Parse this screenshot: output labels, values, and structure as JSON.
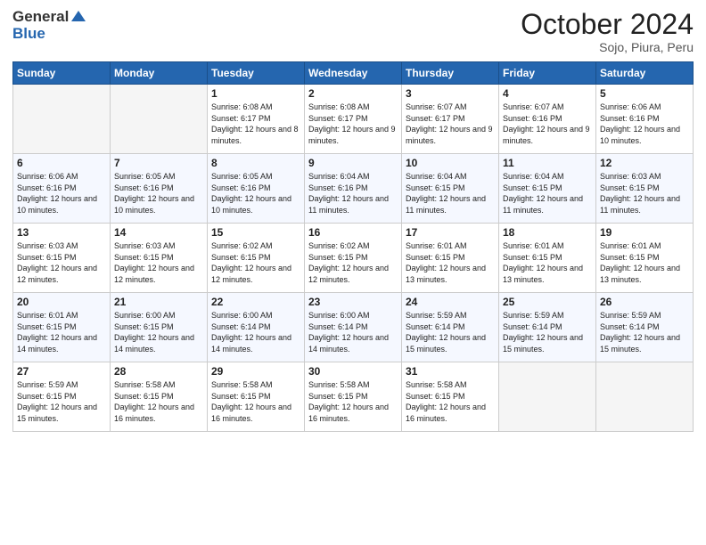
{
  "header": {
    "logo_general": "General",
    "logo_blue": "Blue",
    "month_title": "October 2024",
    "location": "Sojo, Piura, Peru"
  },
  "days_of_week": [
    "Sunday",
    "Monday",
    "Tuesday",
    "Wednesday",
    "Thursday",
    "Friday",
    "Saturday"
  ],
  "weeks": [
    [
      {
        "day": "",
        "info": ""
      },
      {
        "day": "",
        "info": ""
      },
      {
        "day": "1",
        "info": "Sunrise: 6:08 AM\nSunset: 6:17 PM\nDaylight: 12 hours and 8 minutes."
      },
      {
        "day": "2",
        "info": "Sunrise: 6:08 AM\nSunset: 6:17 PM\nDaylight: 12 hours and 9 minutes."
      },
      {
        "day": "3",
        "info": "Sunrise: 6:07 AM\nSunset: 6:17 PM\nDaylight: 12 hours and 9 minutes."
      },
      {
        "day": "4",
        "info": "Sunrise: 6:07 AM\nSunset: 6:16 PM\nDaylight: 12 hours and 9 minutes."
      },
      {
        "day": "5",
        "info": "Sunrise: 6:06 AM\nSunset: 6:16 PM\nDaylight: 12 hours and 10 minutes."
      }
    ],
    [
      {
        "day": "6",
        "info": "Sunrise: 6:06 AM\nSunset: 6:16 PM\nDaylight: 12 hours and 10 minutes."
      },
      {
        "day": "7",
        "info": "Sunrise: 6:05 AM\nSunset: 6:16 PM\nDaylight: 12 hours and 10 minutes."
      },
      {
        "day": "8",
        "info": "Sunrise: 6:05 AM\nSunset: 6:16 PM\nDaylight: 12 hours and 10 minutes."
      },
      {
        "day": "9",
        "info": "Sunrise: 6:04 AM\nSunset: 6:16 PM\nDaylight: 12 hours and 11 minutes."
      },
      {
        "day": "10",
        "info": "Sunrise: 6:04 AM\nSunset: 6:15 PM\nDaylight: 12 hours and 11 minutes."
      },
      {
        "day": "11",
        "info": "Sunrise: 6:04 AM\nSunset: 6:15 PM\nDaylight: 12 hours and 11 minutes."
      },
      {
        "day": "12",
        "info": "Sunrise: 6:03 AM\nSunset: 6:15 PM\nDaylight: 12 hours and 11 minutes."
      }
    ],
    [
      {
        "day": "13",
        "info": "Sunrise: 6:03 AM\nSunset: 6:15 PM\nDaylight: 12 hours and 12 minutes."
      },
      {
        "day": "14",
        "info": "Sunrise: 6:03 AM\nSunset: 6:15 PM\nDaylight: 12 hours and 12 minutes."
      },
      {
        "day": "15",
        "info": "Sunrise: 6:02 AM\nSunset: 6:15 PM\nDaylight: 12 hours and 12 minutes."
      },
      {
        "day": "16",
        "info": "Sunrise: 6:02 AM\nSunset: 6:15 PM\nDaylight: 12 hours and 12 minutes."
      },
      {
        "day": "17",
        "info": "Sunrise: 6:01 AM\nSunset: 6:15 PM\nDaylight: 12 hours and 13 minutes."
      },
      {
        "day": "18",
        "info": "Sunrise: 6:01 AM\nSunset: 6:15 PM\nDaylight: 12 hours and 13 minutes."
      },
      {
        "day": "19",
        "info": "Sunrise: 6:01 AM\nSunset: 6:15 PM\nDaylight: 12 hours and 13 minutes."
      }
    ],
    [
      {
        "day": "20",
        "info": "Sunrise: 6:01 AM\nSunset: 6:15 PM\nDaylight: 12 hours and 14 minutes."
      },
      {
        "day": "21",
        "info": "Sunrise: 6:00 AM\nSunset: 6:15 PM\nDaylight: 12 hours and 14 minutes."
      },
      {
        "day": "22",
        "info": "Sunrise: 6:00 AM\nSunset: 6:14 PM\nDaylight: 12 hours and 14 minutes."
      },
      {
        "day": "23",
        "info": "Sunrise: 6:00 AM\nSunset: 6:14 PM\nDaylight: 12 hours and 14 minutes."
      },
      {
        "day": "24",
        "info": "Sunrise: 5:59 AM\nSunset: 6:14 PM\nDaylight: 12 hours and 15 minutes."
      },
      {
        "day": "25",
        "info": "Sunrise: 5:59 AM\nSunset: 6:14 PM\nDaylight: 12 hours and 15 minutes."
      },
      {
        "day": "26",
        "info": "Sunrise: 5:59 AM\nSunset: 6:14 PM\nDaylight: 12 hours and 15 minutes."
      }
    ],
    [
      {
        "day": "27",
        "info": "Sunrise: 5:59 AM\nSunset: 6:15 PM\nDaylight: 12 hours and 15 minutes."
      },
      {
        "day": "28",
        "info": "Sunrise: 5:58 AM\nSunset: 6:15 PM\nDaylight: 12 hours and 16 minutes."
      },
      {
        "day": "29",
        "info": "Sunrise: 5:58 AM\nSunset: 6:15 PM\nDaylight: 12 hours and 16 minutes."
      },
      {
        "day": "30",
        "info": "Sunrise: 5:58 AM\nSunset: 6:15 PM\nDaylight: 12 hours and 16 minutes."
      },
      {
        "day": "31",
        "info": "Sunrise: 5:58 AM\nSunset: 6:15 PM\nDaylight: 12 hours and 16 minutes."
      },
      {
        "day": "",
        "info": ""
      },
      {
        "day": "",
        "info": ""
      }
    ]
  ]
}
